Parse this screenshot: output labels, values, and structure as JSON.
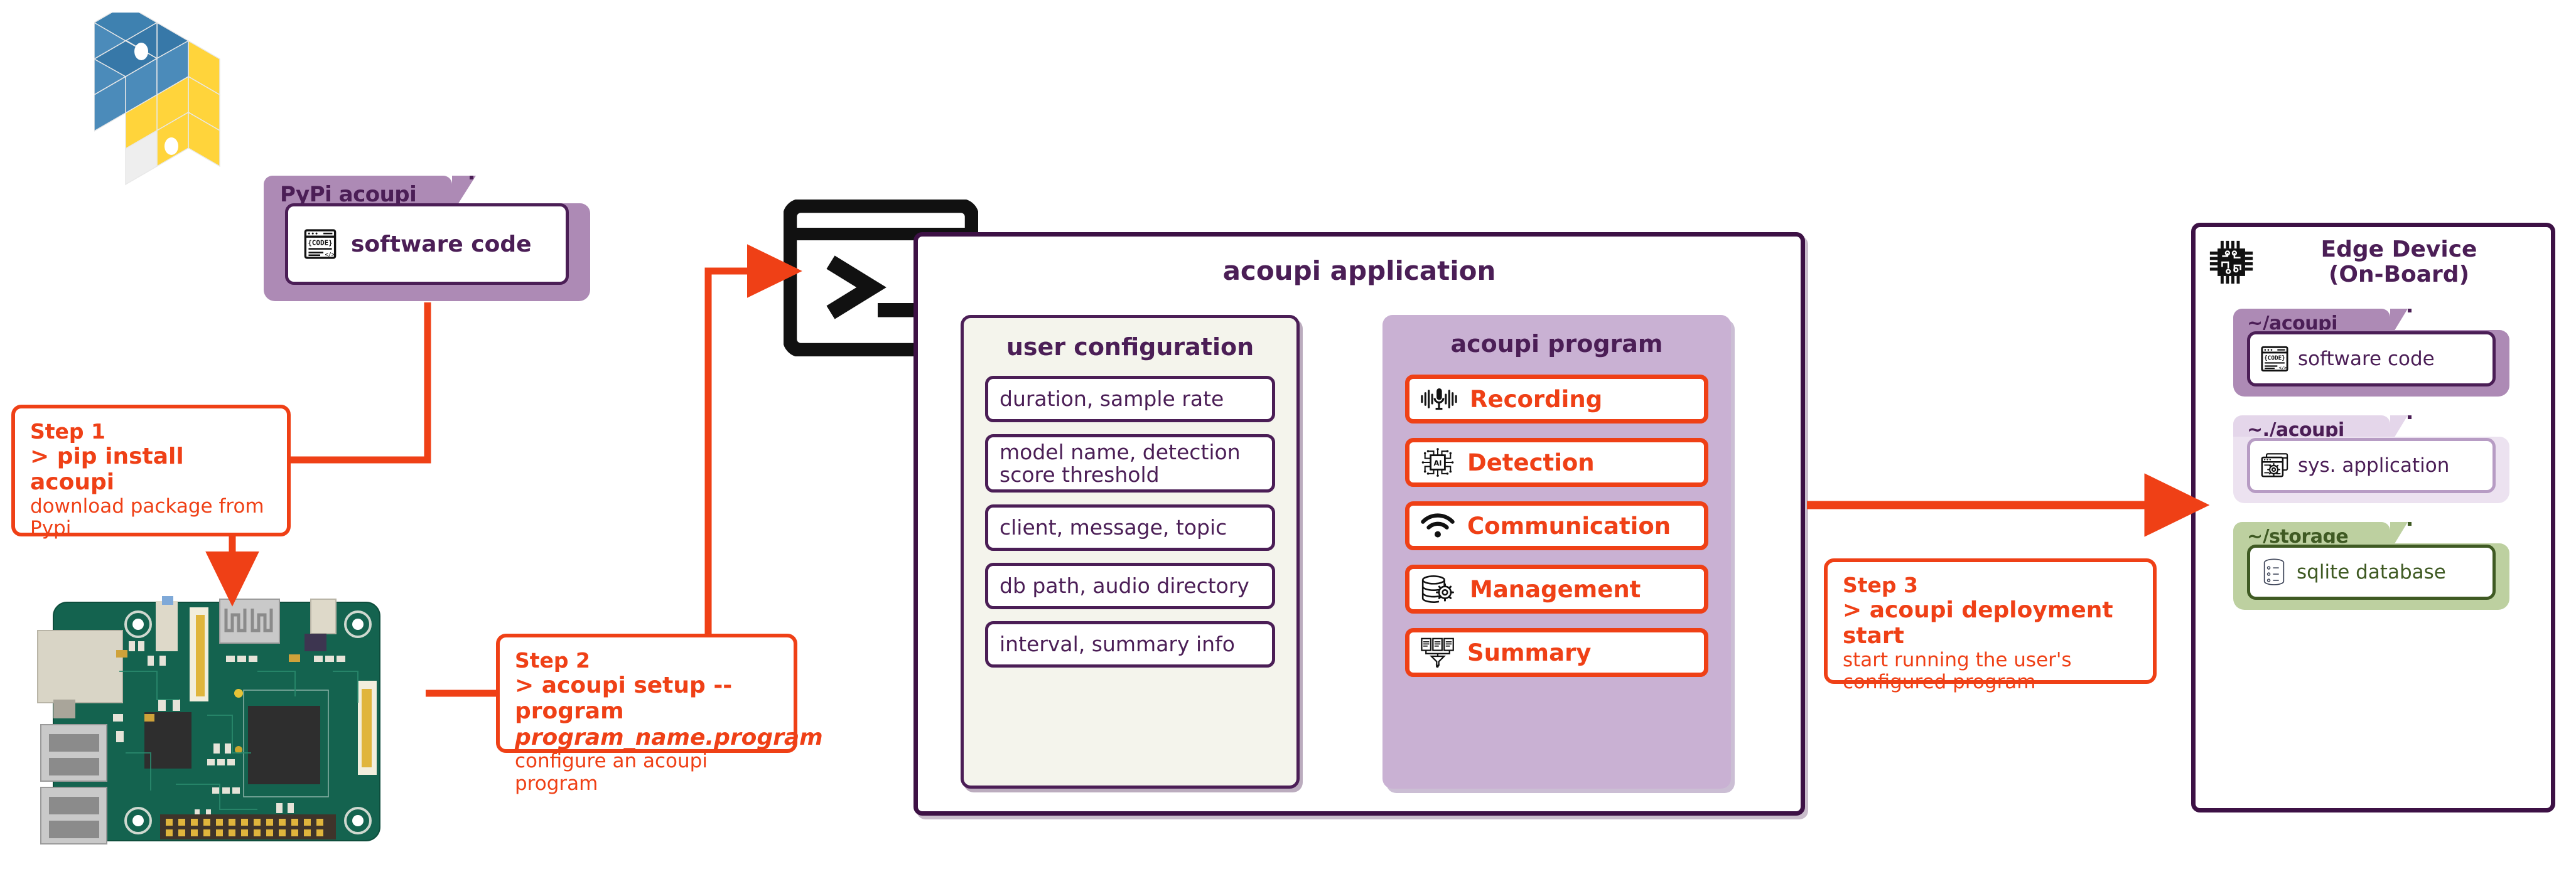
{
  "colors": {
    "accent_orange": "#ef4016",
    "deep_purple": "#4b1e56",
    "panel_purple": "#ad8ab5",
    "light_lilac": "#ece2f0",
    "program_purple": "#c9b1d3",
    "storage_green": "#bdd0a0",
    "green_text": "#3f5a23",
    "config_bg": "#f4f4ec"
  },
  "pypi_folder": {
    "title": "PyPi acoupi",
    "item_label": "software code",
    "item_icon": "code-window-icon"
  },
  "python_logo": {
    "icon": "python-logo-isometric"
  },
  "rpi": {
    "icon": "raspberry-pi-board"
  },
  "terminal": {
    "icon": "terminal-prompt-icon",
    "glyph": ">_"
  },
  "steps": [
    {
      "title": "Step 1",
      "command": "> pip install acoupi",
      "command_italic": "",
      "description": "download package from Pypi"
    },
    {
      "title": "Step 2",
      "command": "> acoupi setup --program",
      "command_italic": "program_name.program",
      "description": "configure an acoupi program"
    },
    {
      "title": "Step 3",
      "command": "> acoupi deployment start",
      "command_italic": "",
      "description": "start running the user's\nconfigured program"
    }
  ],
  "acoupi_application": {
    "title": "acoupi application",
    "user_configuration": {
      "title": "user configuration",
      "items": [
        "duration, sample rate",
        "model name, detection score threshold",
        "client, message, topic",
        "db path, audio directory",
        "interval, summary info"
      ]
    },
    "acoupi_program": {
      "title": "acoupi program",
      "items": [
        {
          "label": "Recording",
          "icon": "microphone-waveform-icon"
        },
        {
          "label": "Detection",
          "icon": "ai-chip-icon"
        },
        {
          "label": "Communication",
          "icon": "wifi-icon"
        },
        {
          "label": "Management",
          "icon": "database-gear-icon"
        },
        {
          "label": "Summary",
          "icon": "documents-funnel-icon"
        }
      ]
    }
  },
  "edge_device": {
    "title": "Edge Device\n(On-Board)",
    "icon": "cpu-chip-icon",
    "folders": [
      {
        "title": "~/acoupi",
        "item_label": "software code",
        "item_icon": "code-window-icon",
        "theme": "purple"
      },
      {
        "title": "~./acoupi",
        "item_label": "sys. application",
        "item_icon": "app-windows-gear-icon",
        "theme": "lilac"
      },
      {
        "title": "~/storage",
        "item_label": "sqlite database",
        "item_icon": "database-cylinder-icon",
        "theme": "green"
      }
    ]
  }
}
